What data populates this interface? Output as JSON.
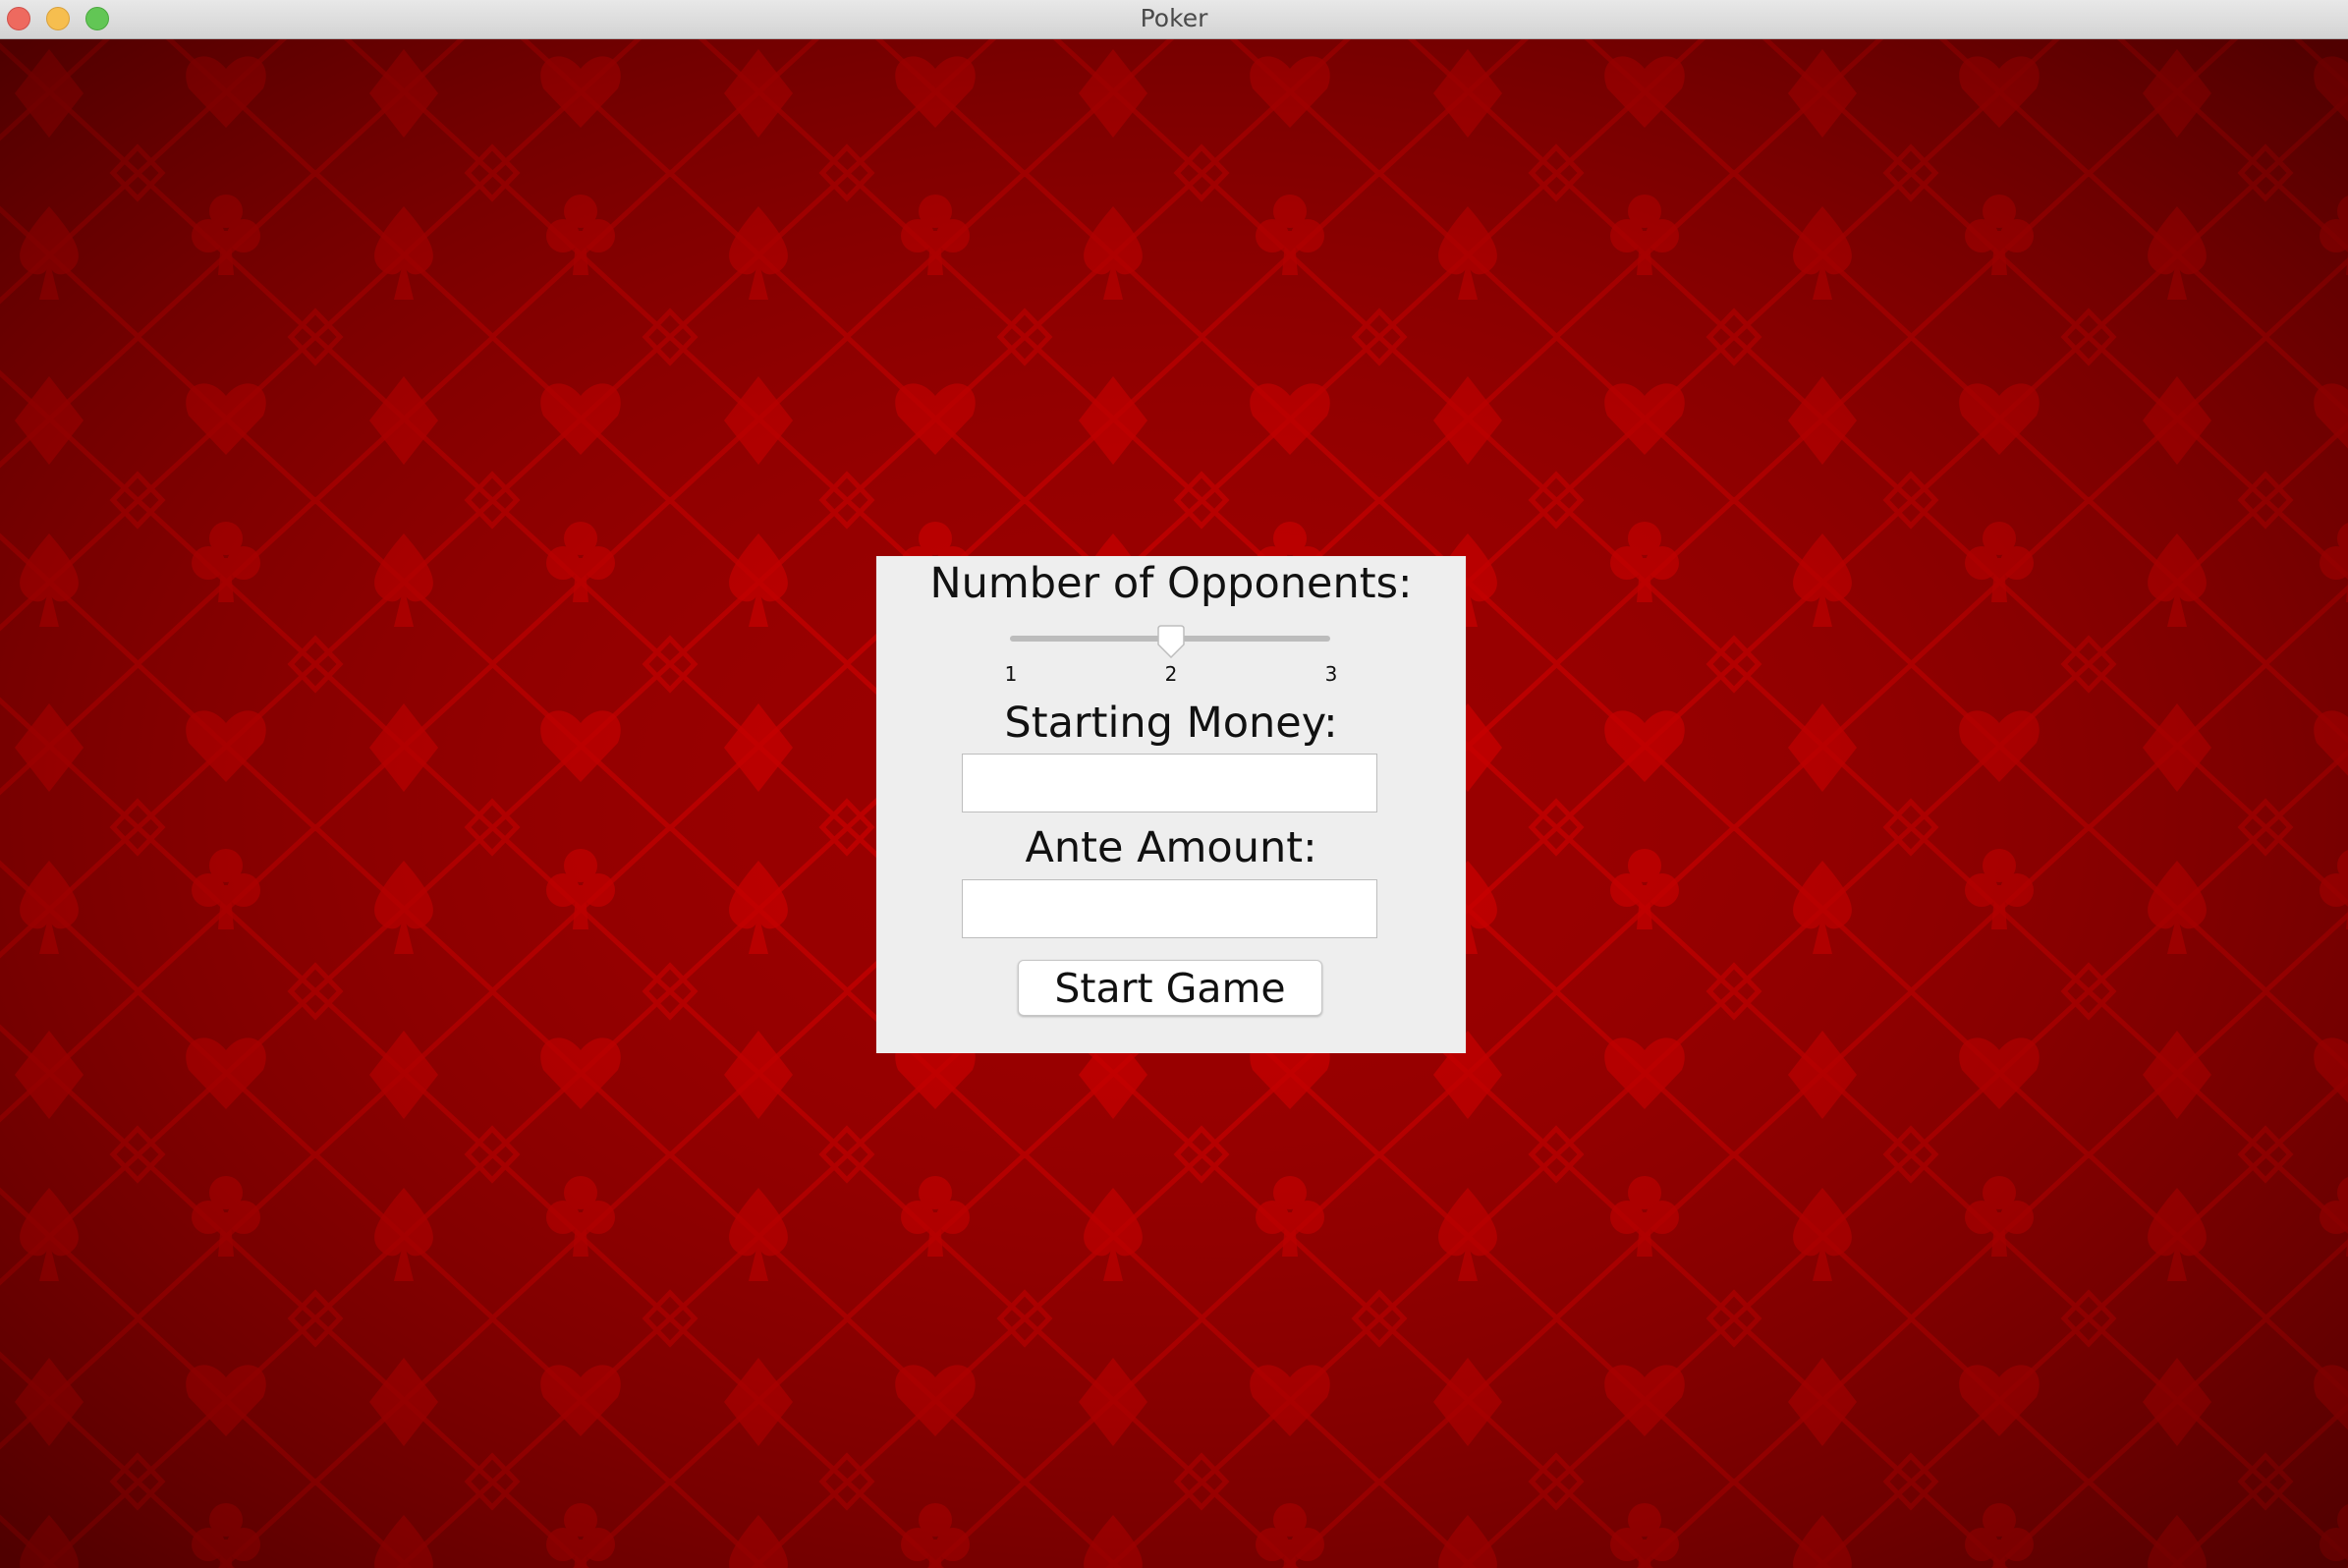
{
  "window": {
    "title": "Poker"
  },
  "background": {
    "icon": "card-suits-pattern",
    "base_color": "#8a0000",
    "accent_color": "#c00000"
  },
  "form": {
    "opponents_label": "Number of Opponents:",
    "opponents_slider": {
      "min": 1,
      "max": 3,
      "value": 2,
      "ticks": [
        "1",
        "2",
        "3"
      ]
    },
    "starting_money_label": "Starting Money:",
    "starting_money_value": "",
    "ante_label": "Ante Amount:",
    "ante_value": "",
    "start_button": "Start Game"
  }
}
